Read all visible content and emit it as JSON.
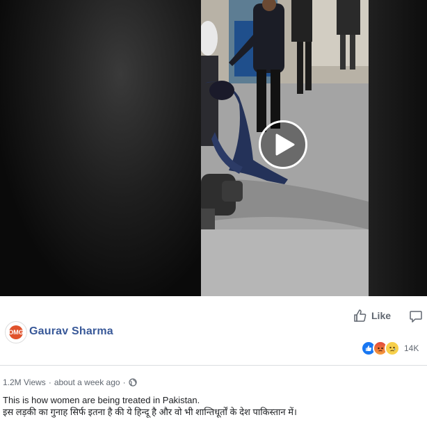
{
  "video": {
    "play_icon": "play-icon"
  },
  "post": {
    "author": "Gaurav Sharma",
    "avatar_text": "OMG",
    "like_label": "Like",
    "reaction_count": "14K",
    "reactions": [
      "like",
      "angry",
      "sad"
    ],
    "views": "1.2M Views",
    "separator": "·",
    "time": "about a week ago",
    "privacy_icon": "globe-icon",
    "caption_line1": "This is how women are being treated in Pakistan.",
    "caption_line2": "इस लड़की का गुनाह सिर्फ इतना है की ये हिन्दू है और वो भी शान्तिधूर्तों के देश पाकिस्तान में।"
  },
  "colors": {
    "author": "#385898",
    "secondary_text": "#606770",
    "like_blue": "#1877f2"
  }
}
